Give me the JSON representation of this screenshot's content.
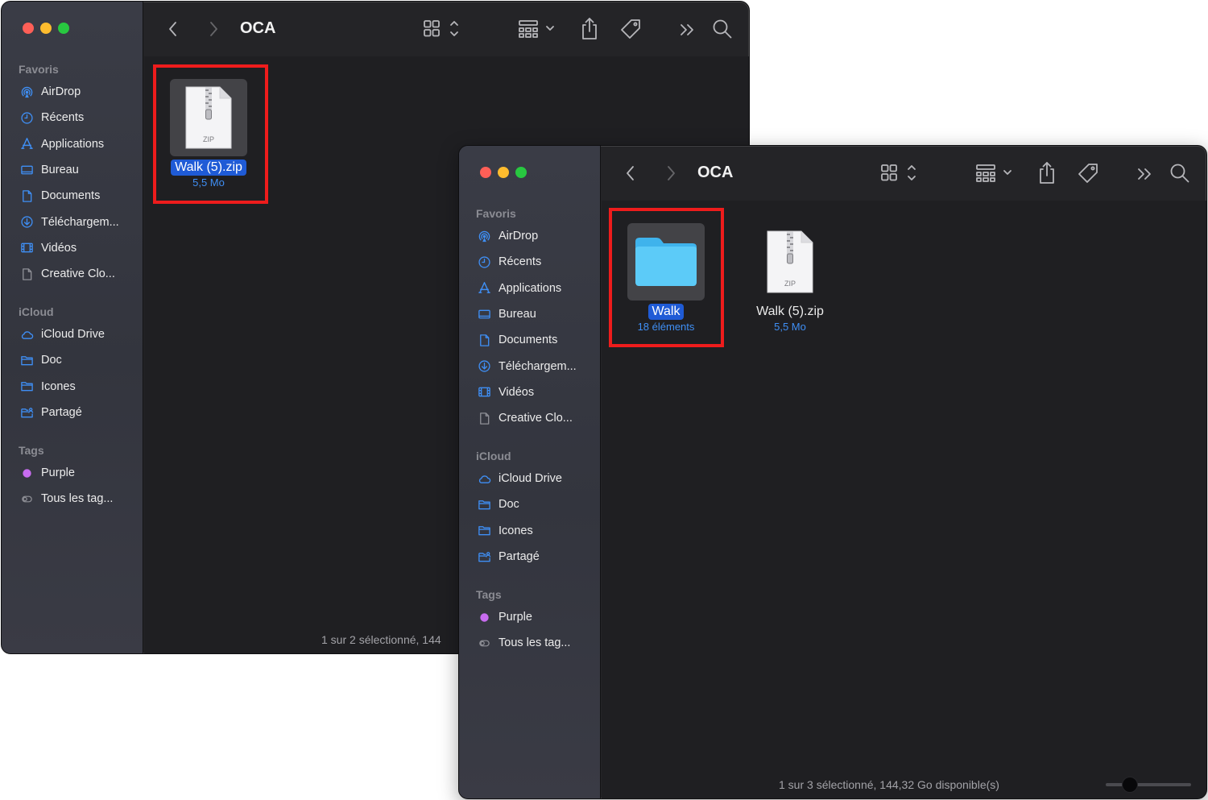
{
  "colors": {
    "accent": "#1f5bd6",
    "meta_blue": "#3f8ff5",
    "highlight_red": "#ee1c1c",
    "tag_purple": "#c86cf0",
    "folder_blue": "#4fc3f7"
  },
  "back_window": {
    "title": "OCA",
    "sidebar": {
      "favorites_header": "Favoris",
      "favorites": [
        {
          "label": "AirDrop",
          "icon": "airdrop-icon"
        },
        {
          "label": "Récents",
          "icon": "clock-icon"
        },
        {
          "label": "Applications",
          "icon": "applications-icon"
        },
        {
          "label": "Bureau",
          "icon": "desktop-icon"
        },
        {
          "label": "Documents",
          "icon": "document-icon"
        },
        {
          "label": "Téléchargem...",
          "icon": "download-icon"
        },
        {
          "label": "Vidéos",
          "icon": "film-icon"
        },
        {
          "label": "Creative Clo...",
          "icon": "file-icon"
        }
      ],
      "icloud_header": "iCloud",
      "icloud": [
        {
          "label": "iCloud Drive",
          "icon": "cloud-icon"
        },
        {
          "label": "Doc",
          "icon": "folder-icon"
        },
        {
          "label": "Icones",
          "icon": "folder-icon"
        },
        {
          "label": "Partagé",
          "icon": "shared-folder-icon"
        }
      ],
      "tags_header": "Tags",
      "tags": [
        {
          "label": "Purple",
          "icon": "purple-dot-icon"
        },
        {
          "label": "Tous les tag...",
          "icon": "all-tags-icon"
        }
      ]
    },
    "files": [
      {
        "name": "Walk (5).zip",
        "meta": "5,5 Mo",
        "type": "zip",
        "selected": true,
        "zip_label": "ZIP"
      }
    ],
    "status": "1 sur 2 sélectionné, 144"
  },
  "front_window": {
    "title": "OCA",
    "sidebar": {
      "favorites_header": "Favoris",
      "favorites": [
        {
          "label": "AirDrop",
          "icon": "airdrop-icon"
        },
        {
          "label": "Récents",
          "icon": "clock-icon"
        },
        {
          "label": "Applications",
          "icon": "applications-icon"
        },
        {
          "label": "Bureau",
          "icon": "desktop-icon"
        },
        {
          "label": "Documents",
          "icon": "document-icon"
        },
        {
          "label": "Téléchargem...",
          "icon": "download-icon"
        },
        {
          "label": "Vidéos",
          "icon": "film-icon"
        },
        {
          "label": "Creative Clo...",
          "icon": "file-icon"
        }
      ],
      "icloud_header": "iCloud",
      "icloud": [
        {
          "label": "iCloud Drive",
          "icon": "cloud-icon"
        },
        {
          "label": "Doc",
          "icon": "folder-icon"
        },
        {
          "label": "Icones",
          "icon": "folder-icon"
        },
        {
          "label": "Partagé",
          "icon": "shared-folder-icon"
        }
      ],
      "tags_header": "Tags",
      "tags": [
        {
          "label": "Purple",
          "icon": "purple-dot-icon"
        },
        {
          "label": "Tous les tag...",
          "icon": "all-tags-icon"
        }
      ]
    },
    "files": [
      {
        "name": "Walk",
        "meta": "18 éléments",
        "type": "folder",
        "selected": true
      },
      {
        "name": "Walk (5).zip",
        "meta": "5,5 Mo",
        "type": "zip",
        "selected": false,
        "zip_label": "ZIP"
      }
    ],
    "status": "1 sur 3 sélectionné, 144,32 Go disponible(s)",
    "icon_size_slider": 0.28
  }
}
